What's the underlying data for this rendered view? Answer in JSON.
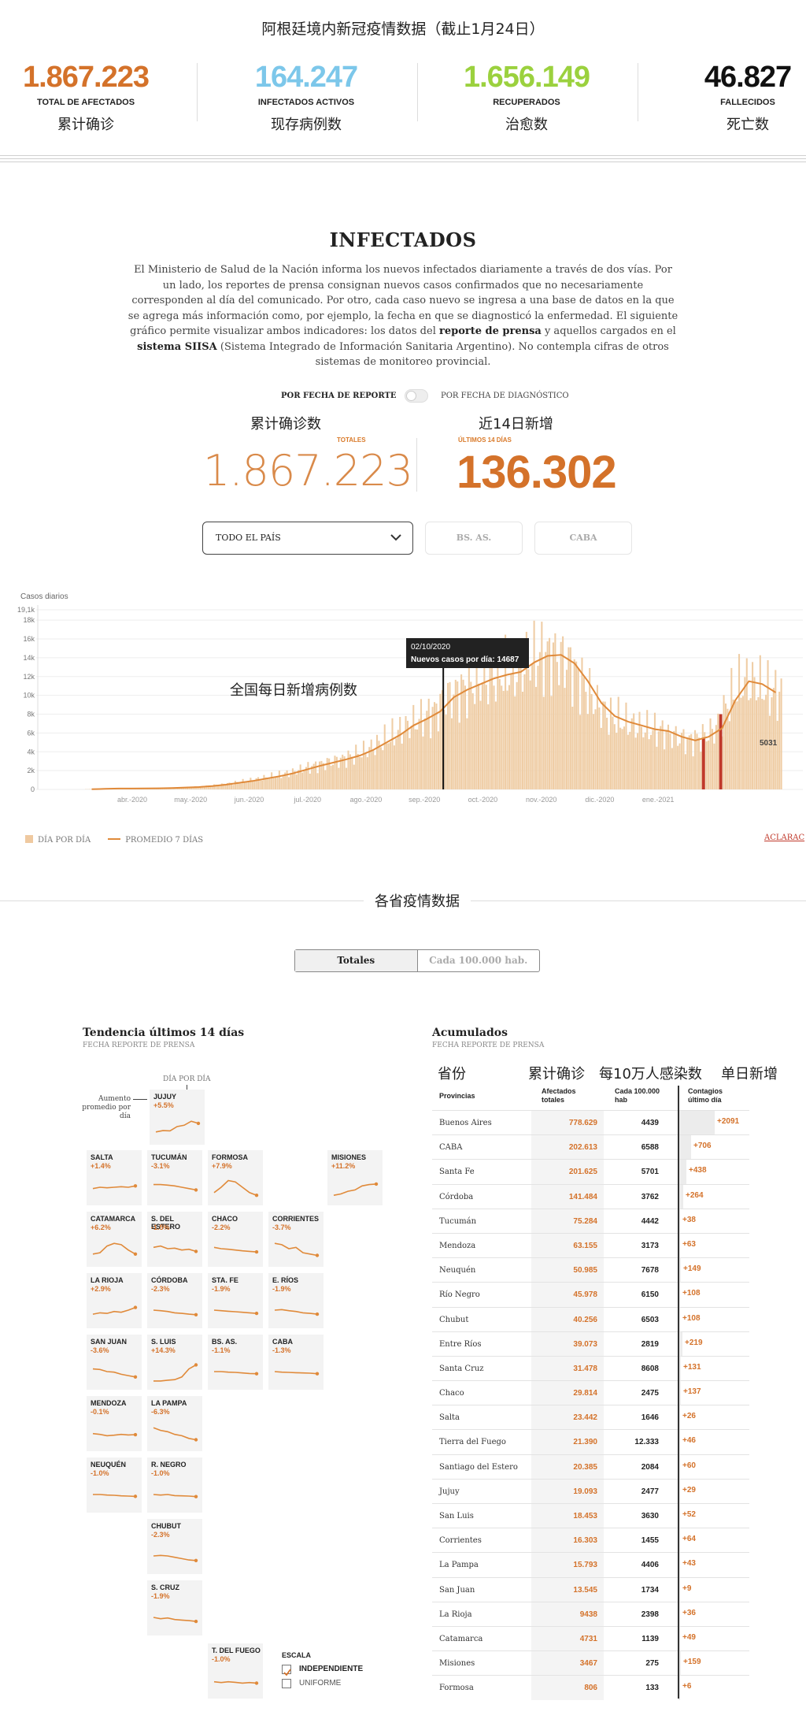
{
  "header": {
    "title": "阿根廷境内新冠疫情数据（截止1月24日）",
    "stats": [
      {
        "value": "1.867.223",
        "label": "TOTAL DE AFECTADOS",
        "cn": "累计确诊",
        "color": "#d4722a"
      },
      {
        "value": "164.247",
        "label": "INFECTADOS ACTIVOS",
        "cn": "现存病例数",
        "color": "#7cc7ea"
      },
      {
        "value": "1.656.149",
        "label": "RECUPERADOS",
        "cn": "治愈数",
        "color": "#9bd13e"
      },
      {
        "value": "46.827",
        "label": "FALLECIDOS",
        "cn": "死亡数",
        "color": "#111111"
      }
    ]
  },
  "infectados": {
    "title": "INFECTADOS",
    "intro_parts": [
      "El Ministerio de Salud de la Nación informa los nuevos infectados diariamente a través de dos vías. Por un lado, los reportes de prensa consignan nuevos casos confirmados que no necesariamente corresponden al día del comunicado. Por otro, cada caso nuevo se ingresa a una base de datos en la que se agrega más información como, por ejemplo, la fecha en que se diagnosticó la enfermedad. El siguiente gráfico permite visualizar ambos indicadores: los datos del ",
      "reporte de prensa",
      " y aquellos cargados en el ",
      "sistema SIISA",
      " (Sistema Integrado de Información Sanitaria Argentino). No contempla cifras de otros sistemas de monitoreo provincial."
    ],
    "toggle_left": "POR FECHA DE REPORTE",
    "toggle_right": "POR FECHA DE DIAGNÓSTICO",
    "kpi_total_cn": "累计确诊数",
    "kpi_total_label": "TOTALES",
    "kpi_total_value": "1.867.223",
    "kpi_14_cn": "近14日新增",
    "kpi_14_label": "ÚLTIMOS 14 DÍAS",
    "kpi_14_value": "136.302",
    "select_value": "TODO EL PAÍS",
    "pill_1": "BS. AS.",
    "pill_2": "CABA",
    "chart_annotation_cn": "全国每日新增病例数",
    "legend_bar": "DÍA POR DÍA",
    "legend_line": "PROMEDIO 7 DÍAS",
    "aclaracion": "ACLARAC",
    "tooltip_date": "02/10/2020",
    "tooltip_text": "Nuevos casos por día: 14687",
    "last_value_label": "5031"
  },
  "chart_data": {
    "type": "bar",
    "title": "",
    "ylabel": "Casos diarios",
    "ylim": [
      0,
      19100
    ],
    "y_ticks": [
      "0",
      "2k",
      "4k",
      "6k",
      "8k",
      "10k",
      "12k",
      "14k",
      "16k",
      "18k",
      "19,1k"
    ],
    "x_ticks": [
      "abr.-2020",
      "may.-2020",
      "jun.-2020",
      "jul.-2020",
      "ago.-2020",
      "sep.-2020",
      "oct.-2020",
      "nov.-2020",
      "dic.-2020",
      "ene.-2021"
    ],
    "series": [
      {
        "name": "DÍA POR DÍA",
        "type": "bar"
      },
      {
        "name": "PROMEDIO 7 DÍAS",
        "type": "line"
      }
    ],
    "weekly_avg": [
      20,
      60,
      90,
      90,
      100,
      120,
      150,
      200,
      250,
      350,
      500,
      700,
      900,
      1150,
      1400,
      1700,
      2100,
      2500,
      2850,
      3200,
      3600,
      4200,
      5000,
      5800,
      6800,
      7500,
      8300,
      9800,
      10600,
      11200,
      11800,
      12200,
      12500,
      13500,
      14200,
      14300,
      13400,
      11500,
      9200,
      7800,
      7200,
      6800,
      6400,
      6200,
      5600,
      5200,
      5600,
      6500,
      9500,
      11500,
      11200,
      10300
    ],
    "highlight": {
      "date": "02/10/2020",
      "value": 14687
    },
    "last_value": 5031
  },
  "provincias": {
    "title": "各省疫情数据",
    "tab_totales": "Totales",
    "tab_cada": "Cada 100.000 hab.",
    "trend_title": "Tendencia últimos 14 días",
    "trend_sub": "FECHA REPORTE DE PRENSA",
    "dia_por_dia": "DÍA POR DÍA",
    "aumento": "Aumento promedio por día",
    "tiles": [
      {
        "name": "JUJUY",
        "pct": "+5.5%",
        "trend": [
          0.3,
          0.35,
          0.34,
          0.5,
          0.55,
          0.7,
          0.62
        ]
      },
      {
        "name": "SALTA",
        "pct": "+1.4%",
        "trend": [
          0.45,
          0.5,
          0.48,
          0.5,
          0.52,
          0.5,
          0.55
        ]
      },
      {
        "name": "TUCUMÁN",
        "pct": "-3.1%",
        "trend": [
          0.6,
          0.6,
          0.58,
          0.55,
          0.5,
          0.45,
          0.4
        ]
      },
      {
        "name": "FORMOSA",
        "pct": "+7.9%",
        "trend": [
          0.3,
          0.5,
          0.75,
          0.7,
          0.5,
          0.3,
          0.2
        ]
      },
      {
        "name": "MISIONES",
        "pct": "+11.2%",
        "trend": [
          0.2,
          0.25,
          0.35,
          0.4,
          0.55,
          0.6,
          0.62
        ]
      },
      {
        "name": "CATAMARCA",
        "pct": "+6.2%",
        "trend": [
          0.3,
          0.35,
          0.6,
          0.7,
          0.65,
          0.45,
          0.3
        ]
      },
      {
        "name": "S. DEL ESTERO",
        "pct": "-1.5%",
        "trend": [
          0.55,
          0.6,
          0.5,
          0.52,
          0.45,
          0.48,
          0.4
        ]
      },
      {
        "name": "CHACO",
        "pct": "-2.2%",
        "trend": [
          0.55,
          0.5,
          0.48,
          0.45,
          0.42,
          0.4,
          0.38
        ]
      },
      {
        "name": "CORRIENTES",
        "pct": "-3.7%",
        "trend": [
          0.7,
          0.65,
          0.5,
          0.55,
          0.35,
          0.3,
          0.25
        ]
      },
      {
        "name": "LA RIOJA",
        "pct": "+2.9%",
        "trend": [
          0.35,
          0.4,
          0.38,
          0.45,
          0.42,
          0.5,
          0.6
        ]
      },
      {
        "name": "CÓRDOBA",
        "pct": "-2.3%",
        "trend": [
          0.5,
          0.48,
          0.45,
          0.4,
          0.38,
          0.35,
          0.33
        ]
      },
      {
        "name": "STA. FE",
        "pct": "-1.9%",
        "trend": [
          0.5,
          0.48,
          0.46,
          0.44,
          0.42,
          0.4,
          0.38
        ]
      },
      {
        "name": "E. RÍOS",
        "pct": "-1.9%",
        "trend": [
          0.5,
          0.52,
          0.48,
          0.45,
          0.4,
          0.38,
          0.35
        ]
      },
      {
        "name": "SAN JUAN",
        "pct": "-3.6%",
        "trend": [
          0.6,
          0.58,
          0.5,
          0.48,
          0.4,
          0.35,
          0.3
        ]
      },
      {
        "name": "S. LUIS",
        "pct": "+14.3%",
        "trend": [
          0.15,
          0.15,
          0.18,
          0.2,
          0.3,
          0.6,
          0.75
        ]
      },
      {
        "name": "BS. AS.",
        "pct": "-1.1%",
        "trend": [
          0.5,
          0.5,
          0.48,
          0.47,
          0.45,
          0.43,
          0.42
        ]
      },
      {
        "name": "CABA",
        "pct": "-1.3%",
        "trend": [
          0.5,
          0.48,
          0.47,
          0.46,
          0.45,
          0.44,
          0.42
        ]
      },
      {
        "name": "MENDOZA",
        "pct": "-0.1%",
        "trend": [
          0.48,
          0.45,
          0.4,
          0.42,
          0.45,
          0.43,
          0.44
        ]
      },
      {
        "name": "LA PAMPA",
        "pct": "-6.3%",
        "trend": [
          0.7,
          0.6,
          0.55,
          0.45,
          0.4,
          0.3,
          0.25
        ]
      },
      {
        "name": "NEUQUÉN",
        "pct": "-1.0%",
        "trend": [
          0.5,
          0.5,
          0.48,
          0.47,
          0.45,
          0.44,
          0.43
        ]
      },
      {
        "name": "R. NEGRO",
        "pct": "-1.0%",
        "trend": [
          0.5,
          0.48,
          0.5,
          0.46,
          0.45,
          0.44,
          0.42
        ]
      },
      {
        "name": "CHUBUT",
        "pct": "-2.3%",
        "trend": [
          0.5,
          0.52,
          0.5,
          0.45,
          0.4,
          0.35,
          0.33
        ]
      },
      {
        "name": "S. CRUZ",
        "pct": "-1.9%",
        "trend": [
          0.5,
          0.45,
          0.48,
          0.42,
          0.4,
          0.38,
          0.35
        ]
      },
      {
        "name": "T. DEL FUEGO",
        "pct": "-1.0%",
        "trend": [
          0.45,
          0.42,
          0.45,
          0.43,
          0.4,
          0.42,
          0.4
        ]
      }
    ],
    "escala": "ESCALA",
    "escala_ind": "INDEPENDIENTE",
    "escala_uni": "UNIFORME",
    "acum_title": "Acumulados",
    "acum_sub": "FECHA REPORTE DE PRENSA",
    "cn_headers": [
      "省份",
      "累计确诊",
      "每10万人感染数",
      "单日新增"
    ],
    "th_prov": "Provincias",
    "th_tot": "Afectados totales",
    "th_hab": "Cada 100.000 hab",
    "th_new": "Contagios último día",
    "rows": [
      {
        "prov": "Buenos Aires",
        "tot": "778.629",
        "hab": "4439",
        "new": "+2091",
        "n": 2091
      },
      {
        "prov": "CABA",
        "tot": "202.613",
        "hab": "6588",
        "new": "+706",
        "n": 706
      },
      {
        "prov": "Santa Fe",
        "tot": "201.625",
        "hab": "5701",
        "new": "+438",
        "n": 438
      },
      {
        "prov": "Córdoba",
        "tot": "141.484",
        "hab": "3762",
        "new": "+264",
        "n": 264
      },
      {
        "prov": "Tucumán",
        "tot": "75.284",
        "hab": "4442",
        "new": "+38",
        "n": 38
      },
      {
        "prov": "Mendoza",
        "tot": "63.155",
        "hab": "3173",
        "new": "+63",
        "n": 63
      },
      {
        "prov": "Neuquén",
        "tot": "50.985",
        "hab": "7678",
        "new": "+149",
        "n": 149
      },
      {
        "prov": "Río Negro",
        "tot": "45.978",
        "hab": "6150",
        "new": "+108",
        "n": 108
      },
      {
        "prov": "Chubut",
        "tot": "40.256",
        "hab": "6503",
        "new": "+108",
        "n": 108
      },
      {
        "prov": "Entre Ríos",
        "tot": "39.073",
        "hab": "2819",
        "new": "+219",
        "n": 219
      },
      {
        "prov": "Santa Cruz",
        "tot": "31.478",
        "hab": "8608",
        "new": "+131",
        "n": 131
      },
      {
        "prov": "Chaco",
        "tot": "29.814",
        "hab": "2475",
        "new": "+137",
        "n": 137
      },
      {
        "prov": "Salta",
        "tot": "23.442",
        "hab": "1646",
        "new": "+26",
        "n": 26
      },
      {
        "prov": "Tierra del Fuego",
        "tot": "21.390",
        "hab": "12.333",
        "new": "+46",
        "n": 46
      },
      {
        "prov": "Santiago del Estero",
        "tot": "20.385",
        "hab": "2084",
        "new": "+60",
        "n": 60
      },
      {
        "prov": "Jujuy",
        "tot": "19.093",
        "hab": "2477",
        "new": "+29",
        "n": 29
      },
      {
        "prov": "San Luis",
        "tot": "18.453",
        "hab": "3630",
        "new": "+52",
        "n": 52
      },
      {
        "prov": "Corrientes",
        "tot": "16.303",
        "hab": "1455",
        "new": "+64",
        "n": 64
      },
      {
        "prov": "La Pampa",
        "tot": "15.793",
        "hab": "4406",
        "new": "+43",
        "n": 43
      },
      {
        "prov": "San Juan",
        "tot": "13.545",
        "hab": "1734",
        "new": "+9",
        "n": 9
      },
      {
        "prov": "La Rioja",
        "tot": "9438",
        "hab": "2398",
        "new": "+36",
        "n": 36
      },
      {
        "prov": "Catamarca",
        "tot": "4731",
        "hab": "1139",
        "new": "+49",
        "n": 49
      },
      {
        "prov": "Misiones",
        "tot": "3467",
        "hab": "275",
        "new": "+159",
        "n": 159
      },
      {
        "prov": "Formosa",
        "tot": "806",
        "hab": "133",
        "new": "+6",
        "n": 6
      }
    ]
  }
}
